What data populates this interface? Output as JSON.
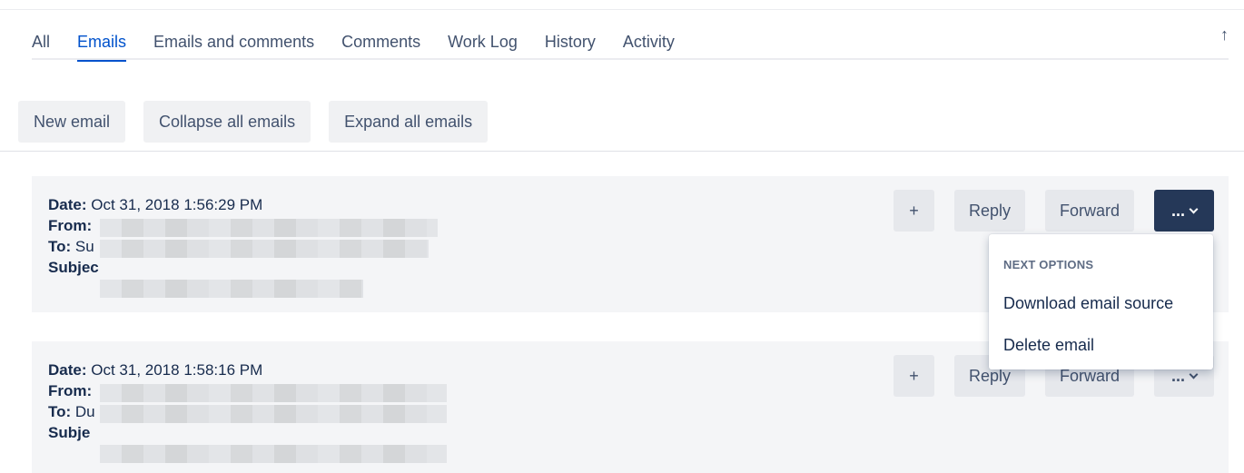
{
  "tabs": [
    {
      "label": "All",
      "active": false
    },
    {
      "label": "Emails",
      "active": true
    },
    {
      "label": "Emails and comments",
      "active": false
    },
    {
      "label": "Comments",
      "active": false
    },
    {
      "label": "Work Log",
      "active": false
    },
    {
      "label": "History",
      "active": false
    },
    {
      "label": "Activity",
      "active": false
    }
  ],
  "scroll_top_glyph": "↑",
  "toolbar": {
    "new_email": "New email",
    "collapse_all": "Collapse all emails",
    "expand_all": "Expand all emails"
  },
  "emails": [
    {
      "date_label": "Date:",
      "date_value": "Oct 31, 2018 1:56:29 PM",
      "from_label": "From:",
      "to_label": "To:",
      "to_partial": "Su",
      "subject_label": "Subjec"
    },
    {
      "date_label": "Date:",
      "date_value": "Oct 31, 2018 1:58:16 PM",
      "from_label": "From:",
      "to_label": "To:",
      "to_partial": "Du",
      "subject_label": "Subje"
    }
  ],
  "actions": {
    "plus": "+",
    "reply": "Reply",
    "forward": "Forward",
    "more": "..."
  },
  "dropdown": {
    "heading": "NEXT OPTIONS",
    "items": [
      "Download email source",
      "Delete email"
    ]
  },
  "colors": {
    "accent": "#0052cc",
    "more_button_active": "#253858",
    "text": "#172b4d"
  }
}
